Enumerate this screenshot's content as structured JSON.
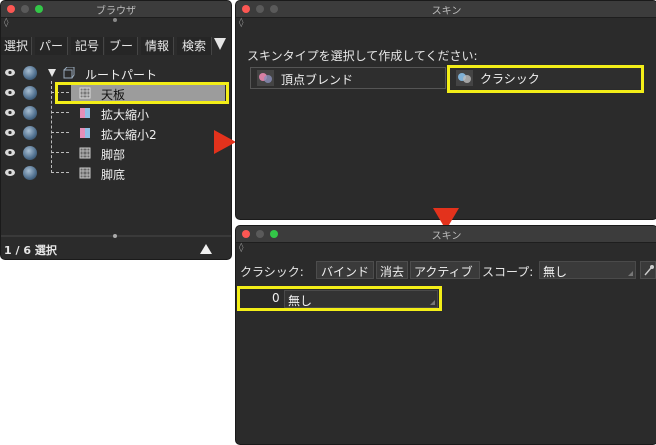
{
  "browser": {
    "title": "ブラウザ",
    "tabs": [
      "選択",
      "パー",
      "記号",
      "ブー",
      "情報",
      "検索"
    ],
    "tree": [
      {
        "label": "ルートパート",
        "kind": "root"
      },
      {
        "label": "天板",
        "kind": "mesh",
        "selected": true
      },
      {
        "label": "拡大縮小",
        "kind": "deformer"
      },
      {
        "label": "拡大縮小2",
        "kind": "deformer"
      },
      {
        "label": "脚部",
        "kind": "mesh"
      },
      {
        "label": "脚底",
        "kind": "mesh"
      }
    ],
    "status": "1 / 6 選択"
  },
  "skin_top": {
    "title": "スキン",
    "prompt": "スキンタイプを選択して作成してください:",
    "options": [
      "頂点ブレンド",
      "クラシック"
    ]
  },
  "skin_bottom": {
    "title": "スキン",
    "classic_label": "クラシック:",
    "buttons": [
      "バインド",
      "消去",
      "アクティブ"
    ],
    "scope_label": "スコープ:",
    "scope_value": "無し",
    "bone_index": "0",
    "bone_value": "無し"
  },
  "colors": {
    "highlight": "#f3ee18",
    "arrow": "#e3321c",
    "selection": "#9c9c9c"
  }
}
